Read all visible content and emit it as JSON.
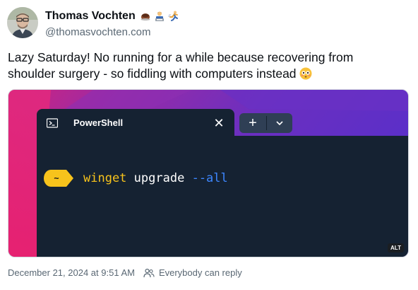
{
  "author": {
    "name": "Thomas Vochten",
    "handle": "@thomasvochten.com",
    "emojis": [
      "coffee-icon",
      "technologist-icon",
      "runner-icon"
    ]
  },
  "post": {
    "text": "Lazy Saturday! No running for a while because recovering from shoulder surgery - so fiddling with computers instead",
    "trailing_emoji": "flushed-face-icon"
  },
  "terminal": {
    "tab_title": "PowerShell",
    "prompt_symbol": "~",
    "command": {
      "program": "winget",
      "subcommand": "upgrade",
      "flag": "--all"
    },
    "colors": {
      "program": "#f7c31c",
      "flag": "#3d87ff",
      "prompt_badge": "#f7c31c",
      "background": "#152232"
    }
  },
  "image": {
    "alt_badge": "ALT"
  },
  "footer": {
    "timestamp": "December 21, 2024 at 9:51 AM",
    "reply_setting": "Everybody can reply"
  }
}
